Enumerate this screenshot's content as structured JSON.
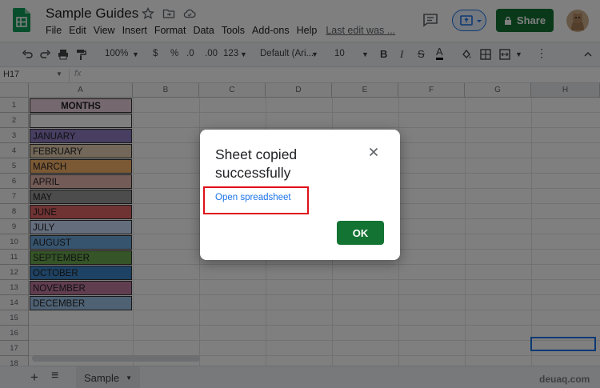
{
  "app": {
    "title": "Sample Guides",
    "menu": [
      "File",
      "Edit",
      "View",
      "Insert",
      "Format",
      "Data",
      "Tools",
      "Add-ons",
      "Help"
    ],
    "last_edit": "Last edit was ...",
    "share_label": "Share"
  },
  "toolbar": {
    "zoom": "100%",
    "currency": "$",
    "percent": "%",
    "dec_less": ".0",
    "dec_more": ".00",
    "num_format": "123",
    "font": "Default (Ari...",
    "font_size": "10",
    "bold": "B",
    "italic": "I",
    "strike": "S",
    "text_color": "A"
  },
  "formula": {
    "cell_ref": "H17",
    "fx": "fx"
  },
  "grid": {
    "columns": [
      "A",
      "B",
      "C",
      "D",
      "E",
      "F",
      "G",
      "H"
    ],
    "rows": [
      "1",
      "2",
      "3",
      "4",
      "5",
      "6",
      "7",
      "8",
      "9",
      "10",
      "11",
      "12",
      "13",
      "14",
      "15",
      "16",
      "17",
      "18"
    ],
    "header": "MONTHS",
    "months": [
      {
        "name": "JANUARY",
        "color": "#8e7cc3"
      },
      {
        "name": "FEBRUARY",
        "color": "#e5cfb0"
      },
      {
        "name": "MARCH",
        "color": "#f6b26b"
      },
      {
        "name": "APRIL",
        "color": "#e6b8af"
      },
      {
        "name": "MAY",
        "color": "#999999"
      },
      {
        "name": "JUNE",
        "color": "#e06666"
      },
      {
        "name": "JULY",
        "color": "#c9daf8"
      },
      {
        "name": "AUGUST",
        "color": "#6fa8dc"
      },
      {
        "name": "SEPTEMBER",
        "color": "#6aa84f"
      },
      {
        "name": "OCTOBER",
        "color": "#3d85c6"
      },
      {
        "name": "NOVEMBER",
        "color": "#c27ba0"
      },
      {
        "name": "DECEMBER",
        "color": "#9fc5e8"
      }
    ],
    "header_color": "#ead1dc"
  },
  "sheets": {
    "add": "+",
    "list": "≡",
    "active_tab": "Sample"
  },
  "dialog": {
    "title": "Sheet copied successfully",
    "link": "Open spreadsheet",
    "ok": "OK"
  },
  "watermark": "deuaq.com",
  "colors": {
    "brand_green": "#137333",
    "link_blue": "#1a73e8",
    "highlight_red": "#e0101b"
  }
}
